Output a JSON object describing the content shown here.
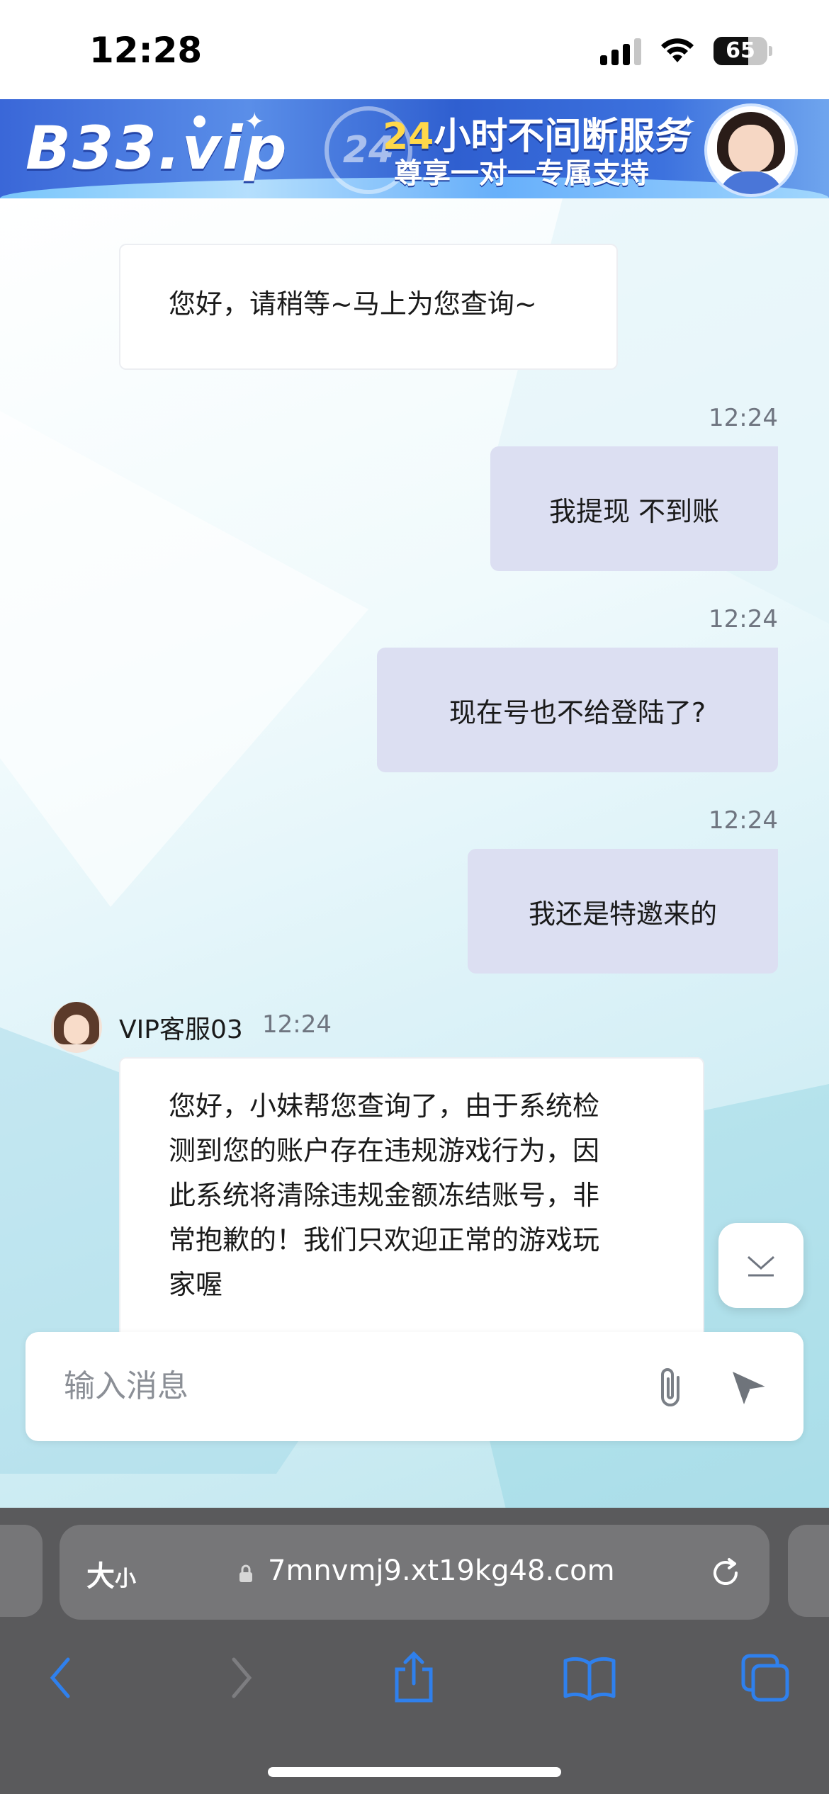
{
  "status_bar": {
    "time": "12:28",
    "battery_percent": "65",
    "battery_level": 0.65
  },
  "banner": {
    "logo": "B33.vip",
    "badge_text": "24",
    "title_accent": "24",
    "title_rest": "小时不间断服务",
    "subtitle": "尊享一对一专属支持"
  },
  "chat": {
    "messages": [
      {
        "side": "agent",
        "text": "您好，请稍等~马上为您查询~"
      },
      {
        "side": "user",
        "time": "12:24",
        "text": "我提现 不到账"
      },
      {
        "side": "user",
        "time": "12:24",
        "text": "现在号也不给登陆了?"
      },
      {
        "side": "user",
        "time": "12:24",
        "text": "我还是特邀来的"
      },
      {
        "side": "agent",
        "name": "VIP客服03",
        "time": "12:24",
        "lines": [
          "您好，小妹帮您查询了，由于系统检",
          "测到您的账户存在违规游戏行为，因",
          "此系统将清除违规金额冻结账号，非",
          "常抱歉的！我们只欢迎正常的游戏玩",
          "家喔"
        ]
      }
    ]
  },
  "input": {
    "placeholder": "输入消息",
    "value": ""
  },
  "browser": {
    "text_size_label_big": "大",
    "text_size_label_small": "小",
    "url": "7mnvmj9.xt19kg48.com"
  },
  "colors": {
    "user_bubble": "#dcdff2",
    "accent_blue": "#2f80ed",
    "chrome_bg": "#5a5a5c"
  },
  "icons": [
    "signal-icon",
    "wifi-icon",
    "battery-icon",
    "paperclip-icon",
    "send-icon",
    "chevron-down-icon",
    "lock-icon",
    "reload-icon",
    "back-icon",
    "forward-icon",
    "share-icon",
    "bookmarks-icon",
    "tabs-icon"
  ]
}
